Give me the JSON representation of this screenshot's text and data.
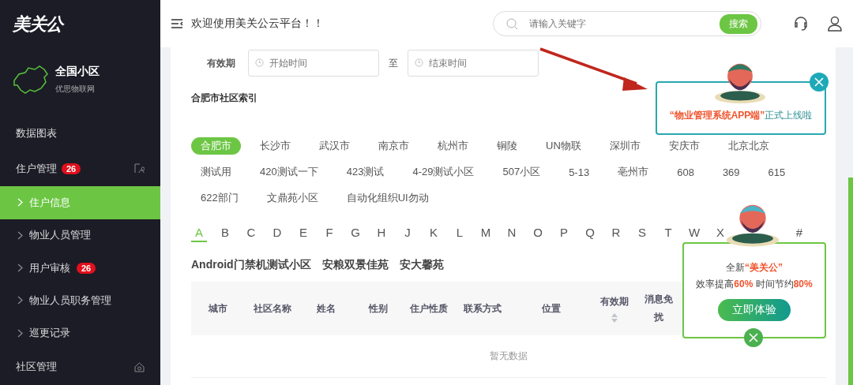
{
  "sidebar": {
    "logo": "美关公",
    "region": {
      "title": "全国小区",
      "subtitle": "优思物联网"
    },
    "menu": [
      {
        "label": "数据图表",
        "expanded": false
      },
      {
        "label": "住户管理",
        "badge": "26",
        "expanded": true,
        "children": [
          {
            "label": "住户信息",
            "selected": true
          },
          {
            "label": "物业人员管理",
            "selected": false
          },
          {
            "label": "用户审核",
            "badge": "26",
            "selected": false
          },
          {
            "label": "物业人员职务管理",
            "selected": false
          },
          {
            "label": "巡更记录",
            "selected": false
          }
        ]
      },
      {
        "label": "社区管理",
        "expanded": false
      }
    ]
  },
  "header": {
    "welcome": "欢迎使用美关公云平台！！",
    "search": {
      "placeholder": "请输入关键字",
      "button": "搜索"
    }
  },
  "filter": {
    "label": "有效期",
    "start_placeholder": "开始时间",
    "separator": "至",
    "end_placeholder": "结束时间"
  },
  "index_title": "合肥市社区索引",
  "cities": [
    {
      "label": "合肥市",
      "selected": true
    },
    {
      "label": "长沙市",
      "selected": false
    },
    {
      "label": "武汉市",
      "selected": false
    },
    {
      "label": "南京市",
      "selected": false
    },
    {
      "label": "杭州市",
      "selected": false
    },
    {
      "label": "铜陵",
      "selected": false
    },
    {
      "label": "UN物联",
      "selected": false
    },
    {
      "label": "深圳市",
      "selected": false
    },
    {
      "label": "安庆市",
      "selected": false
    },
    {
      "label": "北京北京",
      "selected": false
    },
    {
      "label": "测试用",
      "selected": false
    },
    {
      "label": "420测试一下",
      "selected": false
    },
    {
      "label": "423测试",
      "selected": false
    },
    {
      "label": "4-29测试小区",
      "selected": false
    },
    {
      "label": "507小区",
      "selected": false
    },
    {
      "label": "5-13",
      "selected": false
    },
    {
      "label": "亳州市",
      "selected": false
    },
    {
      "label": "608",
      "selected": false
    },
    {
      "label": "369",
      "selected": false
    },
    {
      "label": "615",
      "selected": false
    },
    {
      "label": "622部门",
      "selected": false
    },
    {
      "label": "文鼎苑小区",
      "selected": false
    },
    {
      "label": "自动化组织UI勿动",
      "selected": false
    }
  ],
  "letters": [
    {
      "label": "A",
      "selected": true
    },
    {
      "label": "B",
      "selected": false
    },
    {
      "label": "C",
      "selected": false
    },
    {
      "label": "D",
      "selected": false
    },
    {
      "label": "E",
      "selected": false
    },
    {
      "label": "F",
      "selected": false
    },
    {
      "label": "G",
      "selected": false
    },
    {
      "label": "H",
      "selected": false
    },
    {
      "label": "J",
      "selected": false
    },
    {
      "label": "K",
      "selected": false
    },
    {
      "label": "L",
      "selected": false
    },
    {
      "label": "M",
      "selected": false
    },
    {
      "label": "N",
      "selected": false
    },
    {
      "label": "O",
      "selected": false
    },
    {
      "label": "P",
      "selected": false
    },
    {
      "label": "Q",
      "selected": false
    },
    {
      "label": "R",
      "selected": false
    },
    {
      "label": "S",
      "selected": false
    },
    {
      "label": "T",
      "selected": false
    },
    {
      "label": "W",
      "selected": false
    },
    {
      "label": "X",
      "selected": false
    },
    {
      "label": "#",
      "selected": false
    }
  ],
  "communities": [
    "Android门禁机测试小区",
    "安粮双景佳苑",
    "安大馨苑"
  ],
  "table": {
    "columns": [
      {
        "label": "城市",
        "sortable": false
      },
      {
        "label": "社区名称",
        "sortable": false
      },
      {
        "label": "姓名",
        "sortable": false
      },
      {
        "label": "性别",
        "sortable": false
      },
      {
        "label": "住户性质",
        "sortable": false
      },
      {
        "label": "联系方式",
        "sortable": false
      },
      {
        "label": "位置",
        "sortable": false
      },
      {
        "label": "有效期",
        "sortable": true
      },
      {
        "lines": [
          "消息免",
          "扰"
        ],
        "sortable": false
      }
    ],
    "empty": "暂无数据"
  },
  "promo_app": {
    "text": "**“物业管理系统APP端”**正式上线啦"
  },
  "promo_trial": {
    "line1": "全新**“美关公”**",
    "line2": "效率提高**60%** 时间节约**80%**",
    "button": "立即体验"
  }
}
